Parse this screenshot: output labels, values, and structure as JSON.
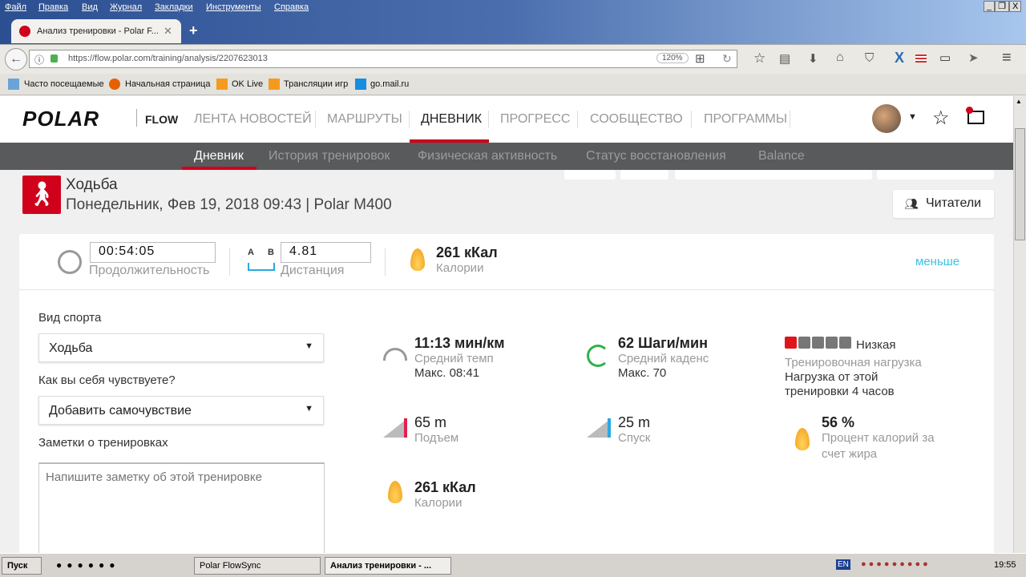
{
  "browser": {
    "menu": [
      "Файл",
      "Правка",
      "Вид",
      "Журнал",
      "Закладки",
      "Инструменты",
      "Справка"
    ],
    "tab_title": "Анализ тренировки - Polar F...",
    "url": "https://flow.polar.com/training/analysis/2207623013",
    "zoom": "120%",
    "bookmarks": [
      "Часто посещаемые",
      "Начальная страница",
      "OK Live",
      "Трансляции игр",
      "go.mail.ru"
    ]
  },
  "header": {
    "brand": "POLAR",
    "product": "FLOW",
    "nav": [
      "ЛЕНТА НОВОСТЕЙ",
      "МАРШРУТЫ",
      "ДНЕВНИК",
      "ПРОГРЕСС",
      "СООБЩЕСТВО",
      "ПРОГРАММЫ"
    ],
    "active": "ДНЕВНИК"
  },
  "subnav": [
    "Дневник",
    "История тренировок",
    "Физическая активность",
    "Статус восстановления",
    "Balance"
  ],
  "training": {
    "sport": "Ходьба",
    "date": "Понедельник, Фев 19, 2018 09:43 | Polar M400",
    "followers_label": "Читатели"
  },
  "summary": {
    "duration": "00:54:05",
    "duration_label": "Продолжительность",
    "ab_a": "A",
    "ab_b": "B",
    "distance": "4.81",
    "distance_label": "Дистанция",
    "calories": "261 кКал",
    "calories_label": "Калории",
    "less_link": "меньше"
  },
  "form": {
    "sport_label": "Вид спорта",
    "sport_value": "Ходьба",
    "feeling_label": "Как вы себя чувствуете?",
    "feeling_value": "Добавить самочувствие",
    "notes_label": "Заметки о тренировках",
    "notes_placeholder": "Напишите заметку об этой тренировке"
  },
  "stats": {
    "pace": "11:13 мин/км",
    "pace_label": "Средний темп",
    "pace_max": "Макс. 08:41",
    "cadence": "62 Шаги/мин",
    "cadence_label": "Средний каденс",
    "cadence_max": "Макс. 70",
    "load_level": "Низкая",
    "load_bars_filled": 1,
    "load_bars_total": 5,
    "load_label": "Тренировочная нагрузка",
    "load_desc1": "Нагрузка от этой",
    "load_desc2": "тренировки 4 часов",
    "ascent": "65 m",
    "ascent_label": "Подъем",
    "descent": "25 m",
    "descent_label": "Спуск",
    "fat": "56 %",
    "fat_label1": "Процент калорий за",
    "fat_label2": "счет жира",
    "calories": "261 кКал",
    "calories_label": "Калории"
  },
  "taskbar": {
    "start": "Пуск",
    "items": [
      "Polar FlowSync",
      "Анализ тренировки - ..."
    ],
    "lang": "EN",
    "clock": "19:55"
  },
  "colors": {
    "accent": "#d0021b",
    "link": "#3ec2e0",
    "subnav": "#585a5c"
  }
}
